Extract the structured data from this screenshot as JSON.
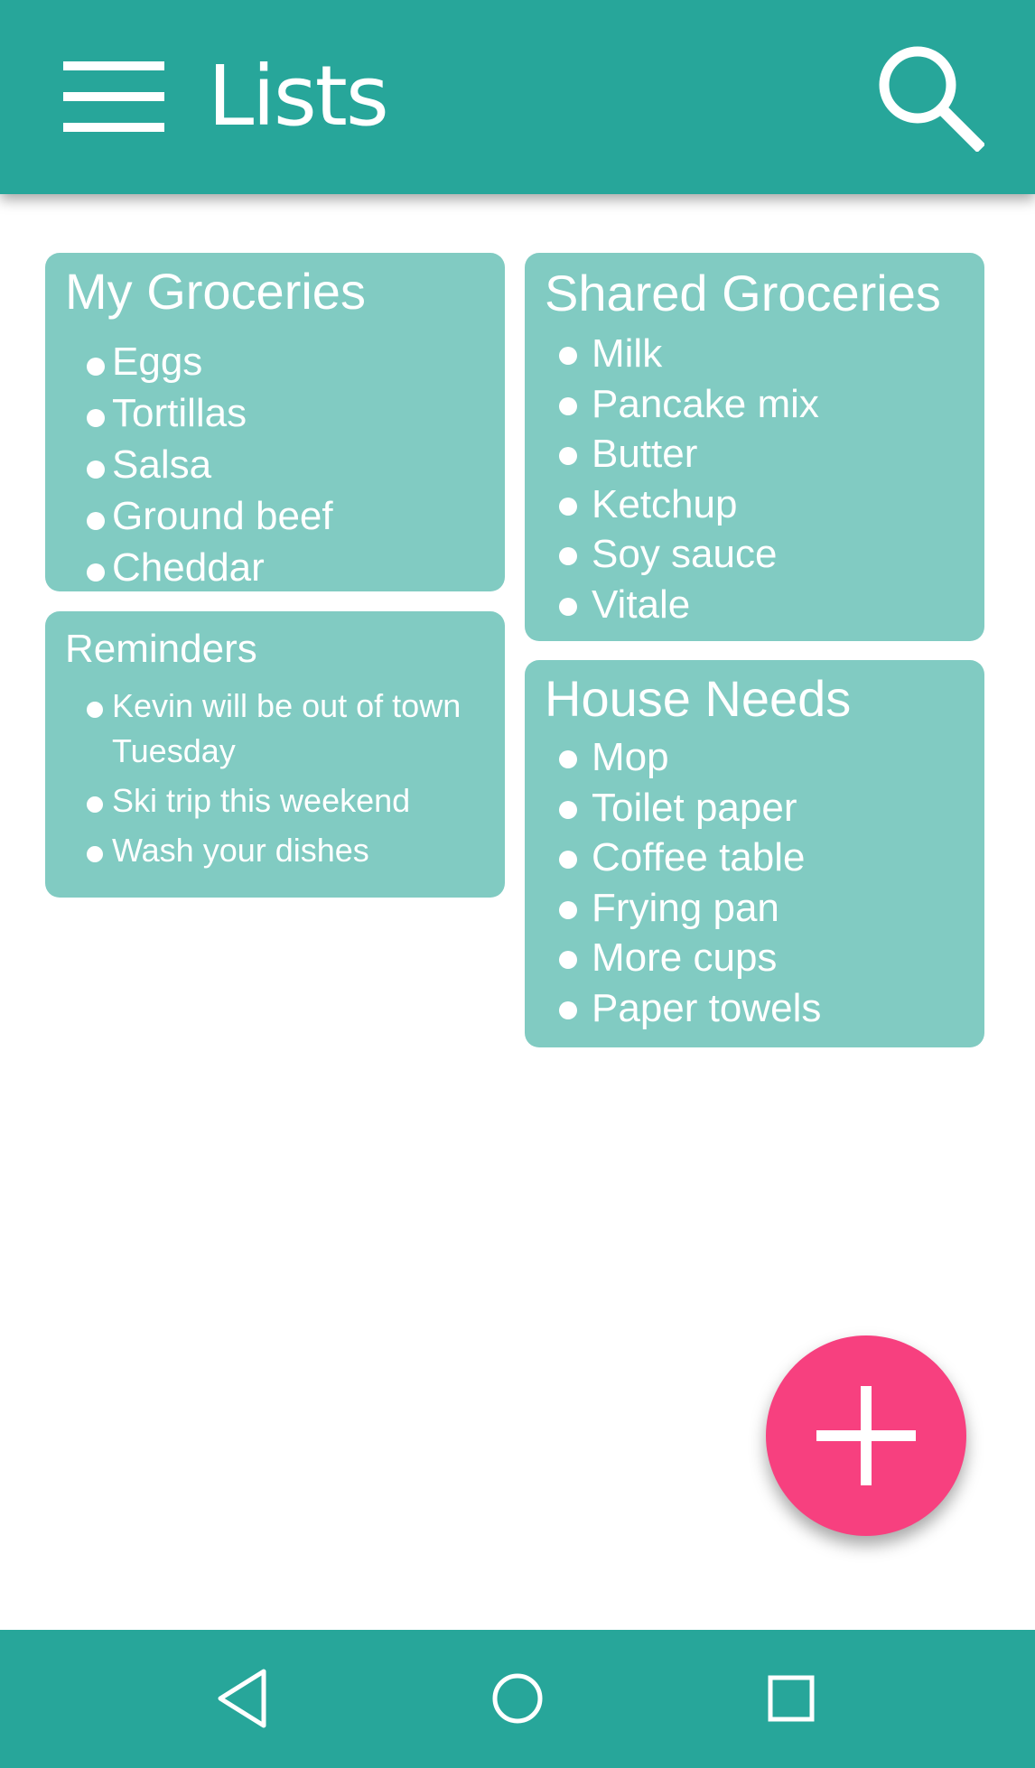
{
  "app_bar": {
    "title": "Lists",
    "background": "#27a69a",
    "menu_icon": "hamburger-menu-icon",
    "search_icon": "search-icon"
  },
  "cards": {
    "my_groceries": {
      "title": "My Groceries",
      "items": [
        "Eggs",
        "Tortillas",
        "Salsa",
        "Ground beef",
        "Cheddar"
      ]
    },
    "shared_groceries": {
      "title": "Shared Groceries",
      "items": [
        "Milk",
        "Pancake mix",
        "Butter",
        "Ketchup",
        "Soy sauce",
        "Vitale"
      ]
    },
    "reminders": {
      "title": "Reminders",
      "items": [
        "Kevin will be out of town Tuesday",
        "Ski trip this weekend",
        "Wash your dishes"
      ]
    },
    "house_needs": {
      "title": "House Needs",
      "items": [
        "Mop",
        "Toilet paper",
        "Coffee table",
        "Frying pan",
        "More cups",
        "Paper towels"
      ]
    }
  },
  "card_color": "#81cbc2",
  "fab": {
    "icon": "plus-icon",
    "color": "#f7407f"
  },
  "nav_bar": {
    "background": "#27a69a",
    "buttons": [
      "back-icon",
      "home-icon",
      "recents-icon"
    ]
  }
}
